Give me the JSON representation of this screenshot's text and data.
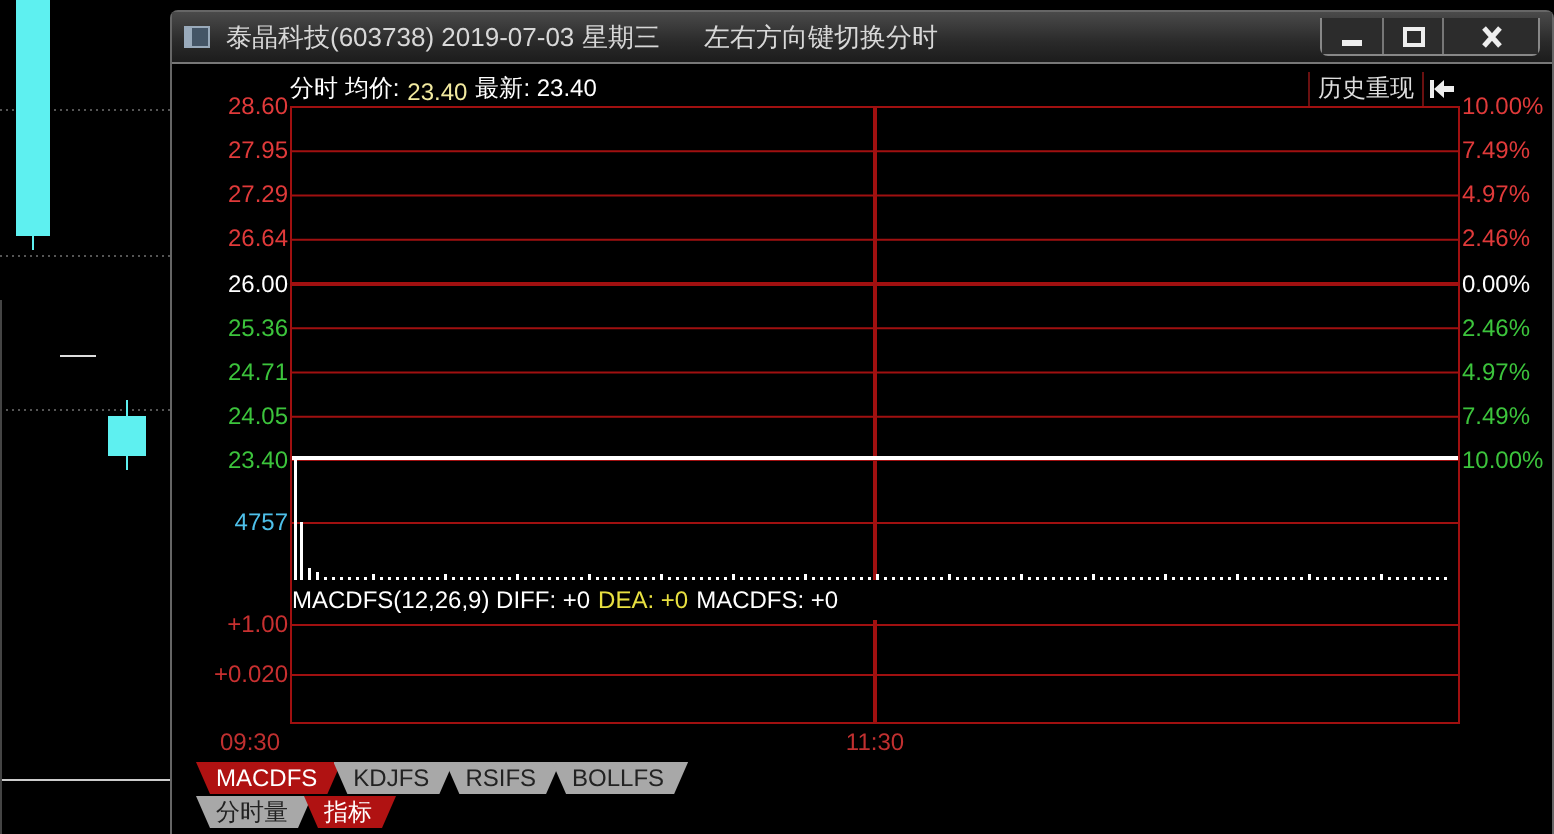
{
  "window": {
    "title": "泰晶科技(603738) 2019-07-03 星期三",
    "hint": "左右方向键切换分时"
  },
  "header": [
    {
      "text": "分时 均价:",
      "color": "#ffffff"
    },
    {
      "text": "23.40",
      "color": "#f2eaa0"
    },
    {
      "text": "最新: 23.40",
      "color": "#ffffff"
    }
  ],
  "history_button": {
    "label": "历史重现"
  },
  "price_axis": [
    "28.60",
    "27.95",
    "27.29",
    "26.64",
    "26.00",
    "25.36",
    "24.71",
    "24.05",
    "23.40"
  ],
  "time_axis": [
    "09:30",
    "11:30"
  ],
  "right_axis": [
    {
      "label": "10.00%",
      "kind": "up"
    },
    {
      "label": "7.49%",
      "kind": "up"
    },
    {
      "label": "4.97%",
      "kind": "up"
    },
    {
      "label": "2.46%",
      "kind": "up"
    },
    {
      "label": "0.00%",
      "kind": "flat"
    },
    {
      "label": "2.46%",
      "kind": "down"
    },
    {
      "label": "4.97%",
      "kind": "down"
    },
    {
      "label": "7.49%",
      "kind": "down"
    },
    {
      "label": "10.00%",
      "kind": "down"
    }
  ],
  "volume": {
    "max_label": "4757"
  },
  "indicator": {
    "segments": [
      {
        "text": "MACDFS(12,26,9) DIFF: +0",
        "color": "#ffffff"
      },
      {
        "text": "DEA: +0",
        "color": "#e8e040"
      },
      {
        "text": "MACDFS: +0",
        "color": "#ffffff"
      }
    ],
    "axis": [
      "+1.00",
      "+0.020"
    ]
  },
  "indicator_tabs": [
    {
      "label": "MACDFS",
      "selected": true
    },
    {
      "label": "KDJFS",
      "selected": false
    },
    {
      "label": "RSIFS",
      "selected": false
    },
    {
      "label": "BOLLFS",
      "selected": false
    }
  ],
  "view_tabs": [
    {
      "label": "分时量",
      "selected": false
    },
    {
      "label": "指标",
      "selected": true
    }
  ]
}
